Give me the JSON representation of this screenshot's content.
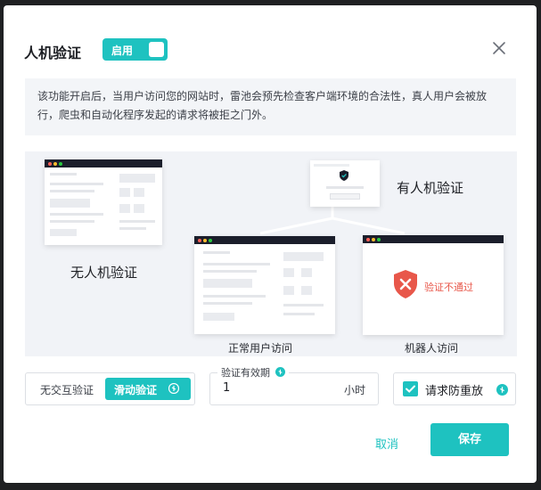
{
  "dialog": {
    "title": "人机验证",
    "enable_toggle": {
      "label": "启用",
      "on": true
    },
    "close_icon": "close-icon",
    "description": "该功能开启后，当用户访问您的网站时，雷池会预先检查客户端环境的合法性，真人用户会被放行，爬虫和自动化程序发起的请求将被拒之门外。"
  },
  "illustration": {
    "no_verify_label": "无人机验证",
    "with_verify_label": "有人机验证",
    "normal_user_label": "正常用户访问",
    "robot_label": "机器人访问",
    "verify_fail_text": "验证不通过"
  },
  "options": {
    "mode_inactive_label": "无交互验证",
    "mode_active_label": "滑动验证",
    "validity_label": "验证有效期",
    "validity_value": "1",
    "validity_unit": "小时",
    "anti_replay_label": "请求防重放",
    "anti_replay_checked": true
  },
  "footer": {
    "cancel_label": "取消",
    "save_label": "保存"
  },
  "colors": {
    "accent": "#1ec2c0",
    "danger": "#e8574a"
  }
}
